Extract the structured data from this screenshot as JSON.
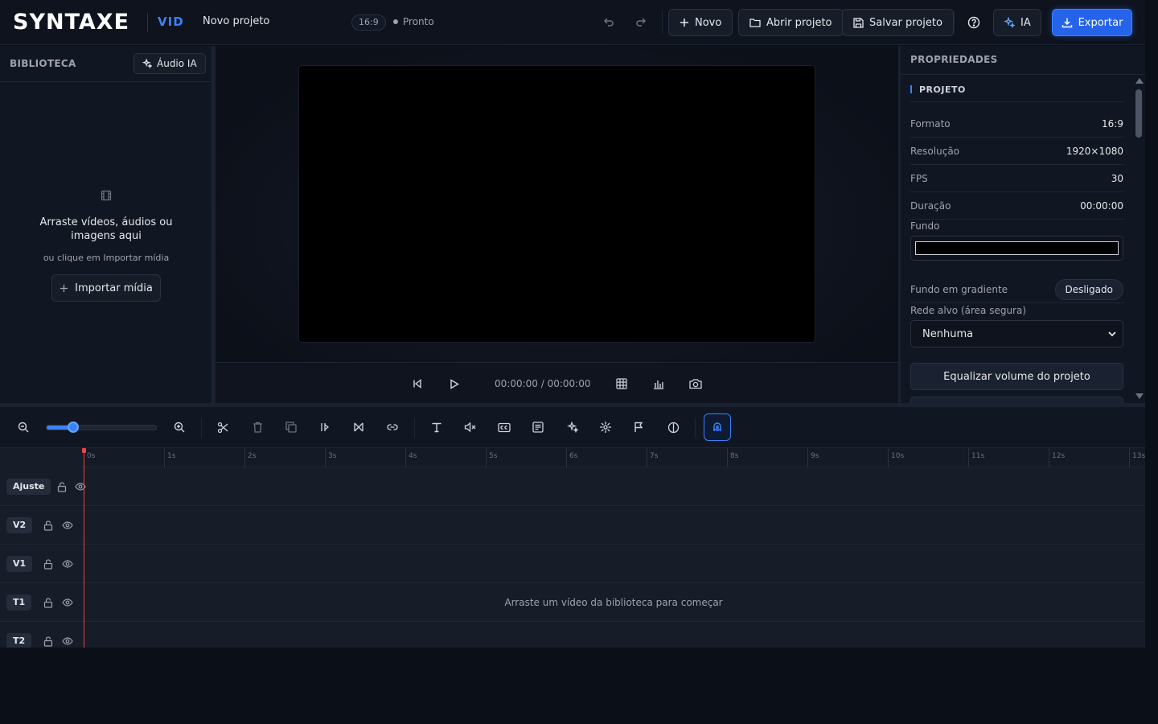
{
  "header": {
    "logo": "SYNTAXE",
    "logo_sub": "VID",
    "project_name": "Novo projeto",
    "ratio": "16:9",
    "status": "Pronto",
    "new_label": "Novo",
    "open_label": "Abrir projeto",
    "save_label": "Salvar projeto",
    "ia_label": "IA",
    "export_label": "Exportar"
  },
  "library": {
    "title": "BIBLIOTECA",
    "audio_ia_label": "Áudio IA",
    "empty_title": "Arraste vídeos, áudios ou imagens aqui",
    "empty_sub": "ou clique em Importar mídia",
    "import_label": "Importar mídia"
  },
  "preview": {
    "timecode": "00:00:00 / 00:00:00"
  },
  "properties": {
    "title": "PROPRIEDADES",
    "section": "PROJETO",
    "rows": [
      {
        "label": "Formato",
        "value": "16:9"
      },
      {
        "label": "Resolução",
        "value": "1920×1080"
      },
      {
        "label": "FPS",
        "value": "30"
      },
      {
        "label": "Duração",
        "value": "00:00:00"
      }
    ],
    "background_label": "Fundo",
    "background_color": "#000000",
    "gradient_label": "Fundo em gradiente",
    "gradient_value": "Desligado",
    "safe_area_label": "Rede alvo (área segura)",
    "safe_area_value": "Nenhuma",
    "equalize_label": "Equalizar volume do projeto"
  },
  "timeline": {
    "zoom": 0.24,
    "ruler": [
      "0s",
      "1s",
      "2s",
      "3s",
      "4s",
      "5s",
      "6s",
      "7s",
      "8s",
      "9s",
      "10s",
      "11s",
      "12s",
      "13s"
    ],
    "tracks": [
      "Ajuste",
      "V2",
      "V1",
      "T1",
      "T2"
    ],
    "hint": "Arraste um vídeo da biblioteca para começar"
  },
  "colors": {
    "accent": "#3b82f6",
    "export": "#2563eb",
    "playhead": "#ef4444"
  }
}
